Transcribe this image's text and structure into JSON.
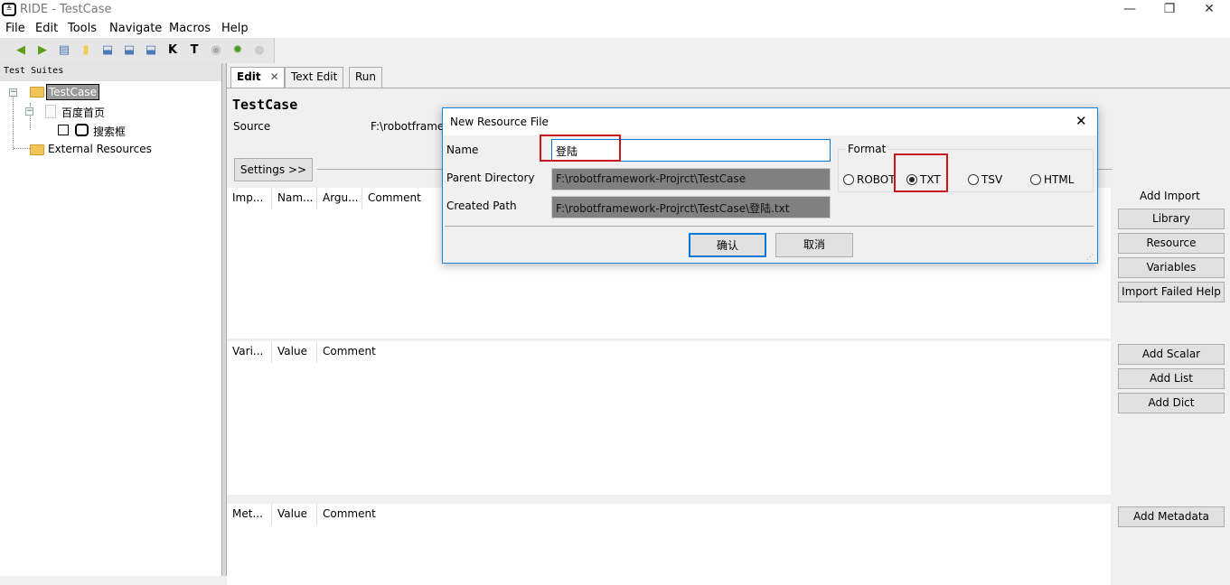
{
  "window": {
    "title": "RIDE - TestCase",
    "controls": [
      "minimize",
      "maximize",
      "close"
    ]
  },
  "menu": [
    "File",
    "Edit",
    "Tools",
    "Navigate",
    "Macros",
    "Help"
  ],
  "toolbar": [
    "back-icon",
    "forward-icon",
    "open-icon",
    "open-directory-icon",
    "save-icon",
    "save-all-icon",
    "save-as-icon",
    "search-keywords-icon",
    "search-tests-icon",
    "run-icon",
    "debug-icon",
    "stop-icon"
  ],
  "left": {
    "header": "Test Suites",
    "tree": [
      {
        "label": "TestCase",
        "selected": true
      },
      {
        "label": "百度首页"
      },
      {
        "label": "搜索框"
      },
      {
        "label": "External Resources"
      }
    ]
  },
  "tabs": [
    {
      "label": "Edit",
      "active": true
    },
    {
      "label": "Text Edit"
    },
    {
      "label": "Run"
    }
  ],
  "edit": {
    "title": "TestCase",
    "source_label": "Source",
    "source_value": "F:\\robotframe",
    "settings_button": "Settings >>",
    "imports": {
      "headers": [
        "Imp...",
        "Nam...",
        "Argu...",
        "Comment"
      ],
      "add_import_label": "Add Import",
      "buttons": [
        "Library",
        "Resource",
        "Variables",
        "Import Failed Help"
      ]
    },
    "variables": {
      "headers": [
        "Vari...",
        "Value",
        "Comment"
      ],
      "buttons": [
        "Add Scalar",
        "Add List",
        "Add Dict"
      ]
    },
    "metadata": {
      "headers": [
        "Met...",
        "Value",
        "Comment"
      ],
      "buttons": [
        "Add Metadata"
      ]
    }
  },
  "dialog": {
    "title": "New Resource File",
    "name_label": "Name",
    "name_value": "登陆",
    "parent_label": "Parent Directory",
    "parent_value": "F:\\robotframework-Projrct\\TestCase",
    "path_label": "Created Path",
    "path_value": "F:\\robotframework-Projrct\\TestCase\\登陆.txt",
    "format_label": "Format",
    "formats": [
      "ROBOT",
      "TXT",
      "TSV",
      "HTML"
    ],
    "selected_format": "TXT",
    "ok": "确认",
    "cancel": "取消"
  },
  "colors": {
    "highlight": "#c8161d",
    "dialog_border": "#1883d7",
    "readonly_field": "#808080"
  }
}
